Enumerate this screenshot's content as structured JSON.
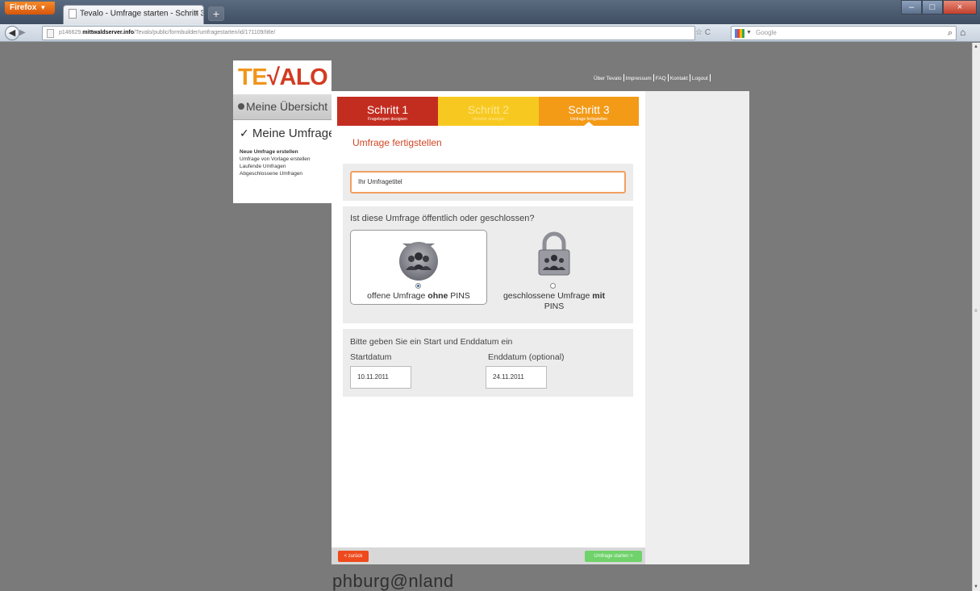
{
  "browser": {
    "menu_button": "Firefox",
    "tab_title": "Tevalo - Umfrage starten - Schritt 3",
    "new_tab": "+",
    "url_prefix": "p146629.",
    "url_domain": "mittwaldserver.info",
    "url_path": "/Tevalo/public/formbuilder/umfragestarten/id/171109/title/",
    "search_placeholder": "Google"
  },
  "logo": {
    "part1": "TE",
    "part2": "√ALO"
  },
  "sidebar": {
    "overview": "Meine Übersicht",
    "section": "Meine Umfragen",
    "items": [
      {
        "label": "Neue Umfrage erstellen",
        "active": true
      },
      {
        "label": "Umfrage von Vorlage erstellen",
        "active": false
      },
      {
        "label": "Laufende Umfragen",
        "active": false
      },
      {
        "label": "Abgeschlossene Umfragen",
        "active": false
      }
    ]
  },
  "toplinks": [
    "Über Tevalo",
    "Impressum",
    "FAQ",
    "Kontakt",
    "Logout"
  ],
  "steps": [
    {
      "title": "Schritt 1",
      "sub": "Fragebogen designen"
    },
    {
      "title": "Schritt 2",
      "sub": "Verteiler anzeigen"
    },
    {
      "title": "Schritt 3",
      "sub": "Umfrage fertigstellen"
    }
  ],
  "page_title": "Umfrage fertigstellen",
  "title_field": {
    "value": "Ihr Umfragetitel"
  },
  "visibility": {
    "question": "Ist diese Umfrage öffentlich oder geschlossen?",
    "open": {
      "pre": "offene Umfrage ",
      "bold": "ohne",
      "post": " PINS",
      "selected": true
    },
    "closed": {
      "pre": "geschlossene Umfrage ",
      "bold": "mit",
      "post": "PINS",
      "selected": false
    }
  },
  "dates": {
    "intro": "Bitte geben Sie ein Start und Enddatum ein",
    "start_label": "Startdatum",
    "start_value": "10.11.2011",
    "end_label": "Enddatum (optional)",
    "end_value": "24.11.2011"
  },
  "footer": {
    "back": "< zurück",
    "start": "Umfrage starten >"
  },
  "brand": "phburg@nland",
  "colors": {
    "step1": "#c32d20",
    "step2": "#f7c920",
    "step3": "#f39a17",
    "accent": "#d04625",
    "go": "#6fd26a"
  }
}
